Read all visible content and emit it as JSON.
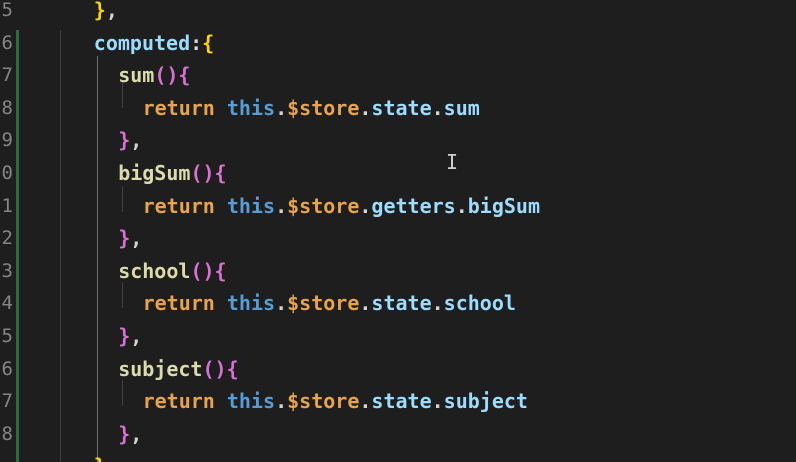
{
  "editor": {
    "line_numbers": [
      "5",
      "6",
      "7",
      "8",
      "9",
      "0",
      "1",
      "2",
      "3",
      "4",
      "5",
      "6",
      "7",
      "8"
    ],
    "lines": [
      {
        "indent": "    ",
        "tokens": [
          {
            "t": "}",
            "c": "t-brace"
          },
          {
            "t": ",",
            "c": "t-punc"
          }
        ]
      },
      {
        "indent": "    ",
        "tokens": [
          {
            "t": "computed",
            "c": "t-var"
          },
          {
            "t": ":",
            "c": "t-punc"
          },
          {
            "t": "{",
            "c": "t-brace"
          }
        ]
      },
      {
        "indent": "      ",
        "tokens": [
          {
            "t": "sum",
            "c": "t-fn"
          },
          {
            "t": "()",
            "c": "t-paren"
          },
          {
            "t": "{",
            "c": "t-paren"
          }
        ]
      },
      {
        "indent": "        ",
        "tokens": [
          {
            "t": "return",
            "c": "t-ret"
          },
          {
            "t": " ",
            "c": "t-punc"
          },
          {
            "t": "this",
            "c": "t-key"
          },
          {
            "t": ".",
            "c": "t-punc"
          },
          {
            "t": "$store",
            "c": "t-ret"
          },
          {
            "t": ".",
            "c": "t-punc"
          },
          {
            "t": "state",
            "c": "t-prop"
          },
          {
            "t": ".",
            "c": "t-punc"
          },
          {
            "t": "sum",
            "c": "t-prop"
          }
        ]
      },
      {
        "indent": "      ",
        "tokens": [
          {
            "t": "}",
            "c": "t-paren"
          },
          {
            "t": ",",
            "c": "t-punc"
          }
        ]
      },
      {
        "indent": "      ",
        "tokens": [
          {
            "t": "bigSum",
            "c": "t-fn"
          },
          {
            "t": "()",
            "c": "t-paren"
          },
          {
            "t": "{",
            "c": "t-paren"
          }
        ]
      },
      {
        "indent": "        ",
        "tokens": [
          {
            "t": "return",
            "c": "t-ret"
          },
          {
            "t": " ",
            "c": "t-punc"
          },
          {
            "t": "this",
            "c": "t-key"
          },
          {
            "t": ".",
            "c": "t-punc"
          },
          {
            "t": "$store",
            "c": "t-ret"
          },
          {
            "t": ".",
            "c": "t-punc"
          },
          {
            "t": "getters",
            "c": "t-prop"
          },
          {
            "t": ".",
            "c": "t-punc"
          },
          {
            "t": "bigSum",
            "c": "t-prop"
          }
        ]
      },
      {
        "indent": "      ",
        "tokens": [
          {
            "t": "}",
            "c": "t-paren"
          },
          {
            "t": ",",
            "c": "t-punc"
          }
        ]
      },
      {
        "indent": "      ",
        "tokens": [
          {
            "t": "school",
            "c": "t-fn"
          },
          {
            "t": "()",
            "c": "t-paren"
          },
          {
            "t": "{",
            "c": "t-paren"
          }
        ]
      },
      {
        "indent": "        ",
        "tokens": [
          {
            "t": "return",
            "c": "t-ret"
          },
          {
            "t": " ",
            "c": "t-punc"
          },
          {
            "t": "this",
            "c": "t-key"
          },
          {
            "t": ".",
            "c": "t-punc"
          },
          {
            "t": "$store",
            "c": "t-ret"
          },
          {
            "t": ".",
            "c": "t-punc"
          },
          {
            "t": "state",
            "c": "t-prop"
          },
          {
            "t": ".",
            "c": "t-punc"
          },
          {
            "t": "school",
            "c": "t-prop"
          }
        ]
      },
      {
        "indent": "      ",
        "tokens": [
          {
            "t": "}",
            "c": "t-paren"
          },
          {
            "t": ",",
            "c": "t-punc"
          }
        ]
      },
      {
        "indent": "      ",
        "tokens": [
          {
            "t": "subject",
            "c": "t-fn"
          },
          {
            "t": "()",
            "c": "t-paren"
          },
          {
            "t": "{",
            "c": "t-paren"
          }
        ]
      },
      {
        "indent": "        ",
        "tokens": [
          {
            "t": "return",
            "c": "t-ret"
          },
          {
            "t": " ",
            "c": "t-punc"
          },
          {
            "t": "this",
            "c": "t-key"
          },
          {
            "t": ".",
            "c": "t-punc"
          },
          {
            "t": "$store",
            "c": "t-ret"
          },
          {
            "t": ".",
            "c": "t-punc"
          },
          {
            "t": "state",
            "c": "t-prop"
          },
          {
            "t": ".",
            "c": "t-punc"
          },
          {
            "t": "subject",
            "c": "t-prop"
          }
        ]
      },
      {
        "indent": "      ",
        "tokens": [
          {
            "t": "}",
            "c": "t-paren"
          },
          {
            "t": ",",
            "c": "t-punc"
          }
        ]
      }
    ],
    "trailing_line": {
      "indent": "    ",
      "tokens": [
        {
          "t": "}",
          "c": "t-brace"
        }
      ]
    },
    "cursor_icon": "text-cursor-icon",
    "colors": {
      "background": "#1e1e1e",
      "line_number": "#858585",
      "property": "#9cdcfe",
      "function": "#dcdcaa",
      "keyword_this": "#569cd6",
      "return_store": "#e8a34c",
      "brace": "#ffd700",
      "paren": "#da70d6"
    }
  }
}
